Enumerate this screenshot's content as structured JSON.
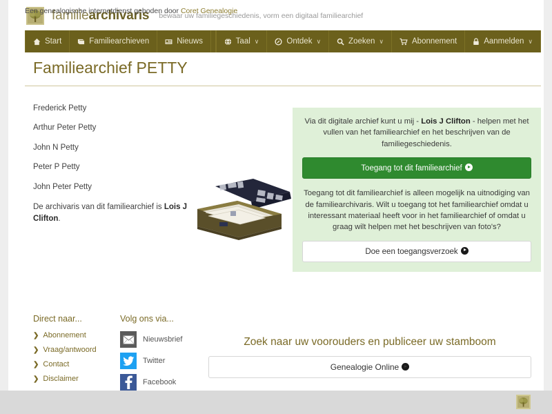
{
  "header": {
    "logo_icon": "tree-logo-icon",
    "brand_light": "familie",
    "brand_bold": "archivaris",
    "tagline": "bewaar uw familiegeschiedenis, vorm een digitaal familiearchief"
  },
  "nav": {
    "left_items": [
      {
        "label": "Start",
        "icon": "home-icon",
        "caret": false
      },
      {
        "label": "Familiearchieven",
        "icon": "book-icon",
        "caret": false
      },
      {
        "label": "Nieuws",
        "icon": "newspaper-icon",
        "caret": false
      }
    ],
    "right_items": [
      {
        "label": "Taal",
        "icon": "globe-icon",
        "caret": true
      },
      {
        "label": "Ontdek",
        "icon": "compass-icon",
        "caret": true
      },
      {
        "label": "Zoeken",
        "icon": "search-icon",
        "caret": true
      },
      {
        "label": "Abonnement",
        "icon": "cart-icon",
        "caret": false
      },
      {
        "label": "Aanmelden",
        "icon": "lock-icon",
        "caret": true
      }
    ],
    "caret_glyph": "∨"
  },
  "page": {
    "title": "Familiearchief PETTY"
  },
  "left": {
    "people": [
      "Frederick Petty",
      "Arthur Peter Petty",
      "John N Petty",
      "Peter P Petty",
      "John Peter Petty"
    ],
    "archivist_prefix": "De archivaris van dit familiearchief is ",
    "archivist_name": "Lois J Clifton",
    "archivist_suffix": ".",
    "photo_alt": "archive-box-photo"
  },
  "panel": {
    "intro_before": "Via dit digitale archief kunt u mij - ",
    "intro_name": "Lois J Clifton",
    "intro_after": " - helpen met het vullen van het familiearchief en het beschrijven van de familiegeschiedenis.",
    "primary_button": "Toegang tot dit familiearchief",
    "body": "Toegang tot dit familiearchief is alleen mogelijk na uitnodiging van de familiearchivaris. Wilt u toegang tot het familiearchief omdat u interessant materiaal heeft voor in het familiearchief of omdat u graag wilt helpen met het beschrijven van foto's?",
    "secondary_button": "Doe een toegangsverzoek",
    "bg_color": "#dff0d8",
    "primary_color": "#2f8a2f"
  },
  "footer": {
    "direct_heading": "Direct naar...",
    "direct_links": [
      "Abonnement",
      "Vraag/antwoord",
      "Contact",
      "Disclaimer"
    ],
    "follow_heading": "Volg ons via...",
    "social": [
      {
        "label": "Nieuwsbrief",
        "icon": "envelope-icon",
        "color": "#5a5a5a"
      },
      {
        "label": "Twitter",
        "icon": "twitter-icon",
        "color": "#1da1f2"
      },
      {
        "label": "Facebook",
        "icon": "facebook-icon",
        "color": "#3b5998"
      }
    ],
    "promo_title": "Zoek naar uw voorouders en publiceer uw stamboom",
    "promo_button": "Genealogie Online"
  },
  "bottom": {
    "text_prefix": "Een genealogische internetdienst geboden door ",
    "link": "Coret Genealogie",
    "logo_icon": "tree-logo-icon"
  }
}
